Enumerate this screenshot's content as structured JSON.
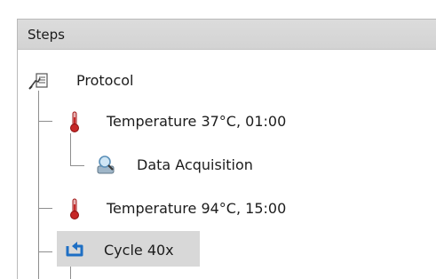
{
  "panel": {
    "title": "Steps"
  },
  "tree": {
    "root": {
      "label": "Protocol",
      "icon": "protocol-icon"
    },
    "steps": [
      {
        "label": "Temperature 37°C, 01:00",
        "icon": "thermometer-icon",
        "children": [
          {
            "label": "Data Acquisition",
            "icon": "data-acquisition-icon"
          }
        ]
      },
      {
        "label": "Temperature 94°C, 15:00",
        "icon": "thermometer-icon"
      },
      {
        "label": "Cycle 40x",
        "icon": "cycle-icon",
        "selected": true
      }
    ]
  },
  "colors": {
    "header_bg": "#d6d6d6",
    "selection_bg": "#d8d8d8",
    "thermometer": "#c62828",
    "cycle": "#1e6fc4"
  }
}
